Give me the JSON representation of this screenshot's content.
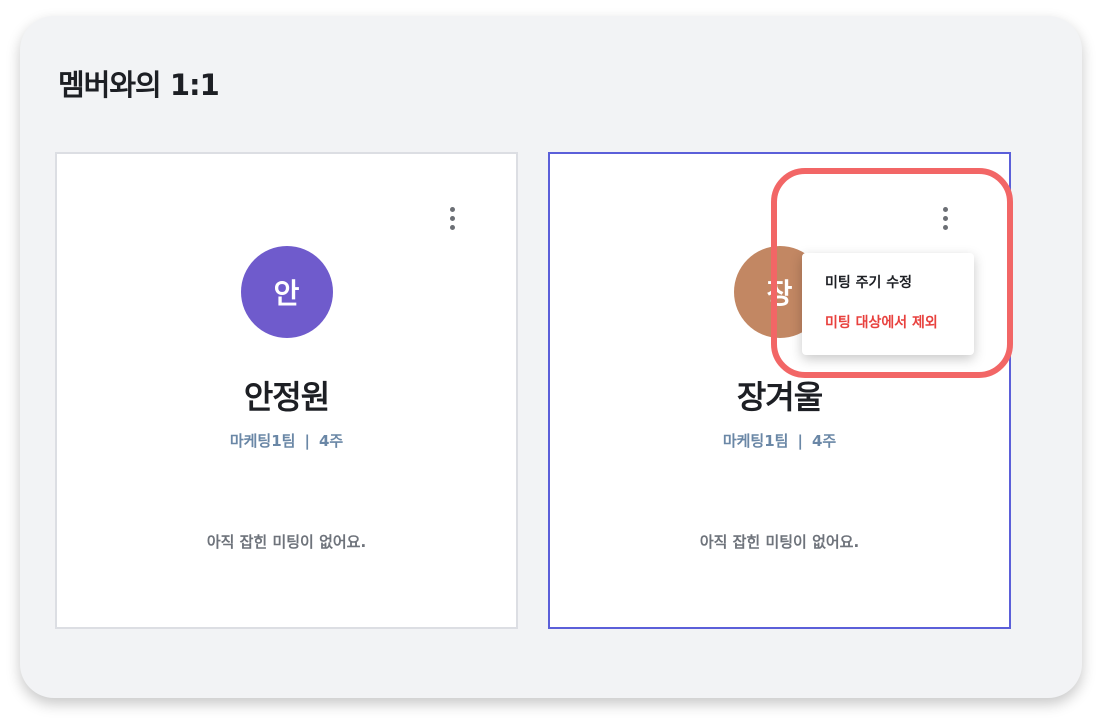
{
  "section": {
    "title": "멤버와의 1:1"
  },
  "members": [
    {
      "avatar_text": "안",
      "avatar_color": "#6f5bcc",
      "name": "안정원",
      "team": "마케팅1팀",
      "separator": "|",
      "period": "4주",
      "empty_text": "아직 잡힌 미팅이 없어요."
    },
    {
      "avatar_text": "장",
      "avatar_color": "#c28763",
      "name": "장겨울",
      "team": "마케팅1팀",
      "separator": "|",
      "period": "4주",
      "empty_text": "아직 잡힌 미팅이 없어요."
    }
  ],
  "menu": {
    "items": [
      {
        "label": "미팅 주기 수정",
        "tone": "default"
      },
      {
        "label": "미팅 대상에서 제외",
        "tone": "danger"
      }
    ]
  },
  "colors": {
    "selected_border": "#5b5fd9",
    "highlight_ring": "#f26666",
    "danger": "#e8413e",
    "meta_text": "#6a87a6"
  },
  "icons": {
    "more": "more-vertical-icon"
  }
}
